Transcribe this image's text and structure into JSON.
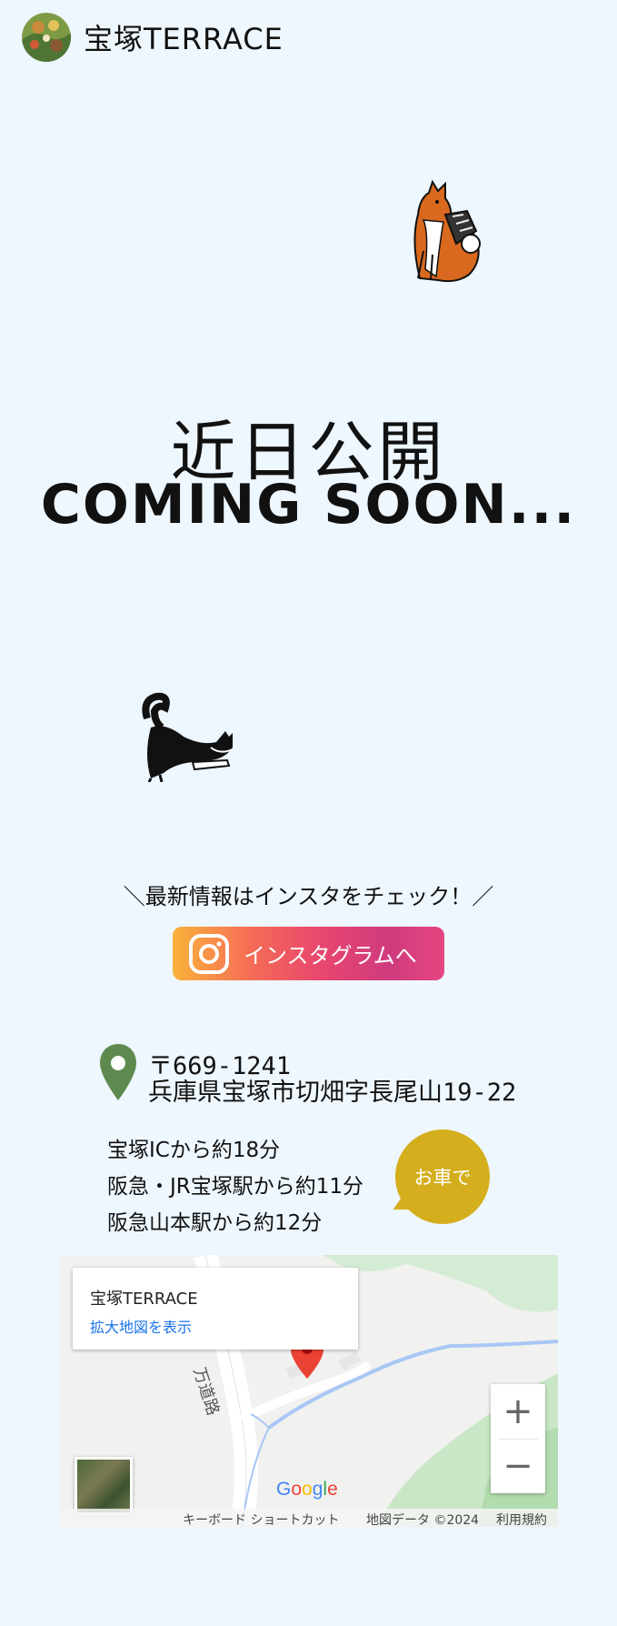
{
  "header": {
    "logo_text": "宝塚TERRACE"
  },
  "hero": {
    "title_jp": "近日公開",
    "title_en": "COMING SOON..."
  },
  "instagram": {
    "message": "＼最新情報はインスタをチェック！／",
    "button_label": "インスタグラムへ"
  },
  "address": {
    "postal": "〒669-1241",
    "line": "兵庫県宝塚市切畑字長尾山19-22"
  },
  "access": {
    "items": [
      "宝塚ICから約18分",
      "阪急・JR宝塚駅から約11分",
      "阪急山本駅から約12分"
    ],
    "badge": "お車で"
  },
  "map": {
    "place_name": "宝塚TERRACE",
    "view_larger": "拡大地図を表示",
    "road_label": "万道路",
    "zoom_in": "+",
    "zoom_out": "−",
    "google_logo": "Google",
    "shortcuts": "キーボード ショートカット",
    "map_data": "地図データ ©2024",
    "terms": "利用規約"
  },
  "colors": {
    "background": "#eef6fe",
    "badge": "#d4ae1c",
    "pin": "#5e8a50",
    "link": "#1a73e8"
  }
}
